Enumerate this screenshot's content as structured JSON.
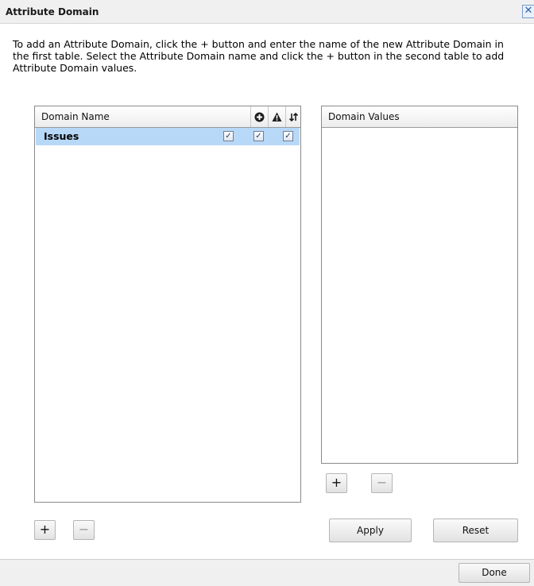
{
  "dialog": {
    "title": "Attribute Domain",
    "close_glyph": "✕",
    "instructions": "To add an Attribute Domain, click the + button and enter the name of the new Attribute Domain in the first table. Select the Attribute Domain name and click the + button in the second table to add Attribute Domain values."
  },
  "domain_table": {
    "columns": [
      "Domain Name",
      "add-circle-icon",
      "warning-icon",
      "sort-arrows-icon"
    ],
    "rows": [
      {
        "name": "Issues",
        "checks": [
          true,
          true,
          true
        ],
        "selected": true
      }
    ],
    "add_label": "+",
    "remove_label": "−"
  },
  "values_table": {
    "header": "Domain Values",
    "add_label": "+",
    "remove_label": "−"
  },
  "actions": {
    "apply_label": "Apply",
    "reset_label": "Reset",
    "done_label": "Done"
  },
  "colors": {
    "selected_row": "#b8d8f8",
    "titlebar": "#f0f0f0"
  }
}
